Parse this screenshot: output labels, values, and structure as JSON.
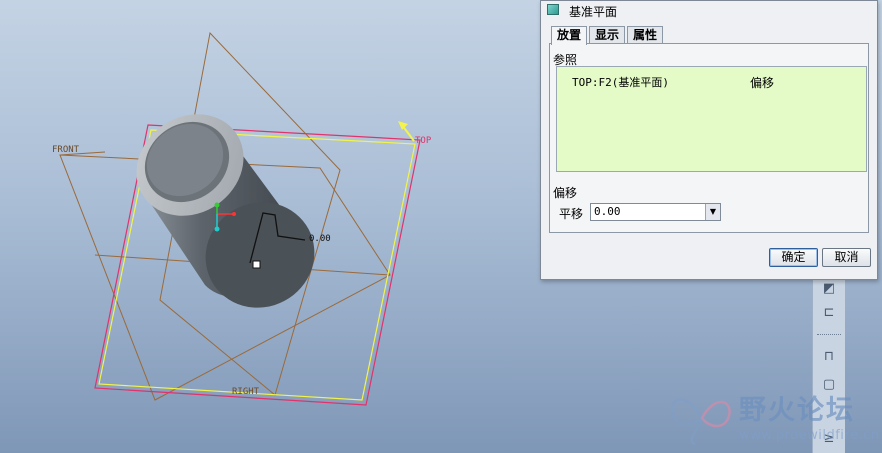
{
  "viewport": {
    "labels": {
      "front": "FRONT",
      "top": "TOP",
      "right": "RIGHT",
      "dimension": "0.00"
    },
    "colors": {
      "datum_plane": "#9a6a3a",
      "top_plane_outer": "#e0336b",
      "top_plane_inner": "#f3f34a",
      "top_label": "#e0336b",
      "cylinder_dark": "#50575e",
      "cylinder_light": "#aeb3b8"
    }
  },
  "dialog": {
    "title": "基准平面",
    "tabs": [
      {
        "label": "放置",
        "active": true
      },
      {
        "label": "显示",
        "active": false
      },
      {
        "label": "属性",
        "active": false
      }
    ],
    "references_label": "参照",
    "reference_item": "TOP:F2(基准平面)",
    "reference_constraint": "偏移",
    "offset_label": "偏移",
    "translate_label": "平移",
    "translate_value": "0.00",
    "ok_label": "确定",
    "cancel_label": "取消",
    "colors": {
      "reference_bg": "#e4fbc8"
    }
  },
  "window_close": "╳",
  "watermark": {
    "title": "野火论坛",
    "url": "www.proewildfire.cn"
  }
}
